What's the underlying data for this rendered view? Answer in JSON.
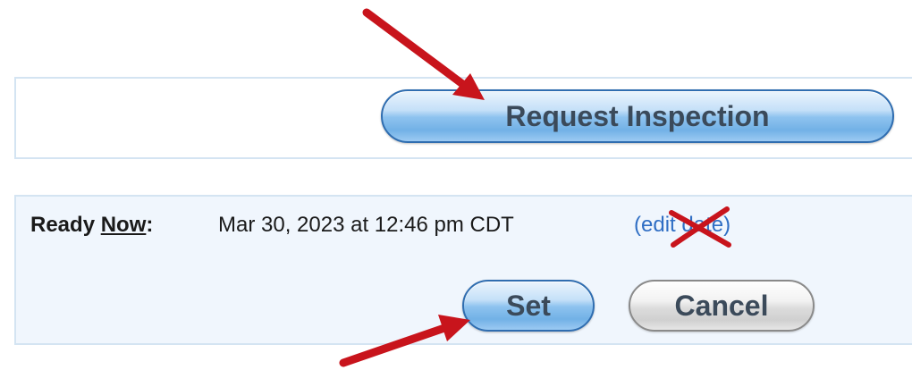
{
  "request_panel": {
    "button_label": "Request Inspection"
  },
  "ready_panel": {
    "label_prefix": "Ready ",
    "label_underlined": "Now",
    "label_suffix": ":",
    "value": "Mar 30, 2023 at 12:46 pm CDT",
    "edit_link": "(edit date)",
    "set_label": "Set",
    "cancel_label": "Cancel"
  },
  "colors": {
    "annotation": "#c8141c",
    "link": "#2f6ec4",
    "panel_border": "#d4e4f2",
    "panel_fill": "#f0f6fd"
  }
}
